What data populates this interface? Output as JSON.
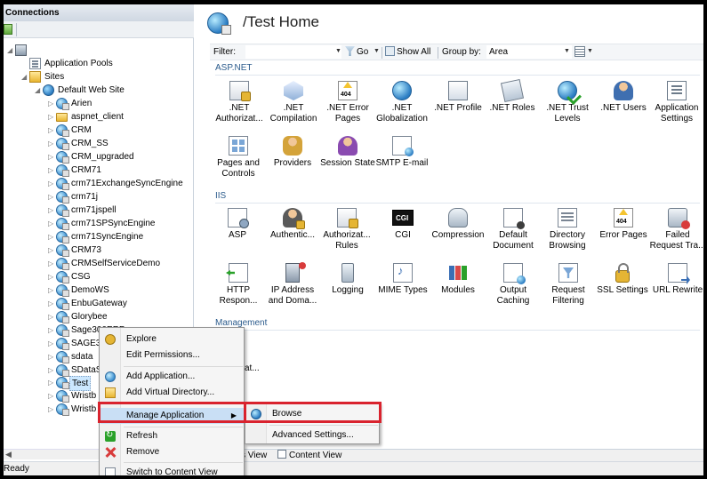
{
  "connections": {
    "title": "Connections",
    "tree": {
      "app_pools": "Application Pools",
      "sites": "Sites",
      "default_site": "Default Web Site",
      "apps": [
        "Arien",
        "aspnet_client",
        "CRM",
        "CRM_SS",
        "CRM_upgraded",
        "CRM71",
        "crm71ExchangeSyncEngine",
        "crm71j",
        "crm71jspell",
        "crm71SPSyncEngine",
        "crm71SyncEngine",
        "CRM73",
        "CRMSelfServiceDemo",
        "CSG",
        "DemoWS",
        "EnbuGateway",
        "Glorybee",
        "Sage300ERP",
        "SAGE3",
        "sdata",
        "SDataS",
        "Test",
        "Wristb",
        "Wristb"
      ]
    }
  },
  "main": {
    "title": "/Test Home",
    "filter": {
      "label": "Filter:",
      "value": "",
      "go": "Go",
      "show_all": "Show All",
      "group_by_label": "Group by:",
      "group_by_value": "Area"
    },
    "sections": {
      "aspnet": "ASP.NET",
      "iis": "IIS",
      "management": "Management"
    },
    "aspnet_features": [
      ".NET Authorizat...",
      ".NET Compilation",
      ".NET Error Pages",
      ".NET Globalization",
      ".NET Profile",
      ".NET Roles",
      ".NET Trust Levels",
      ".NET Users",
      "Application Settings",
      "Pages and Controls",
      "Providers",
      "Session State",
      "SMTP E-mail"
    ],
    "iis_features": [
      "ASP",
      "Authentic...",
      "Authorizat... Rules",
      "CGI",
      "Compression",
      "Default Document",
      "Directory Browsing",
      "Error Pages",
      "Failed Request Tra...",
      "HTTP Respon...",
      "IP Address and Doma...",
      "Logging",
      "MIME Types",
      "Modules",
      "Output Caching",
      "Request Filtering",
      "SSL Settings",
      "URL Rewrite"
    ],
    "management_partial": "at..."
  },
  "view_tabs": {
    "features": "s View",
    "content": "Content View"
  },
  "status": {
    "text": "Ready"
  },
  "context_menu": {
    "items": [
      "Explore",
      "Edit Permissions...",
      "Add Application...",
      "Add Virtual Directory...",
      "Manage Application",
      "Refresh",
      "Remove",
      "Switch to Content View"
    ]
  },
  "submenu": {
    "items": [
      "Browse",
      "Advanced Settings..."
    ]
  },
  "colors": {
    "highlight": "#d9232e",
    "selection": "#cce8ff",
    "section_text": "#2b5b8c"
  }
}
